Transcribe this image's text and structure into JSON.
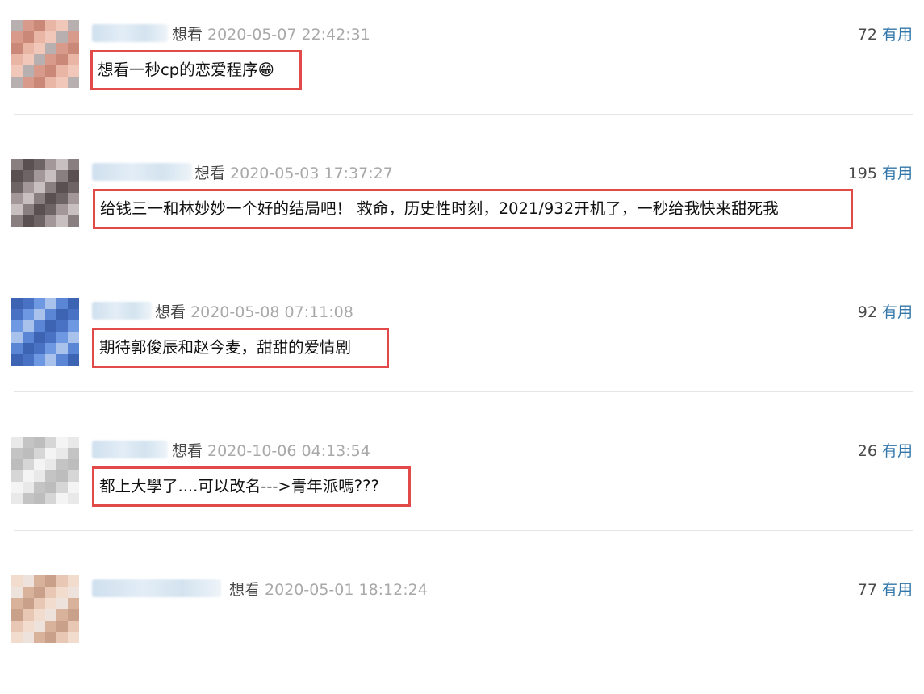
{
  "comments": [
    {
      "status": "想看",
      "time": "2020-05-07 22:42:31",
      "votes": "72",
      "useful": "有用",
      "content": "想看一秒cp的恋爱程序😁"
    },
    {
      "status": "想看",
      "time": "2020-05-03 17:37:27",
      "votes": "195",
      "useful": "有用",
      "content": "给钱三一和林妙妙一个好的结局吧！ 救命，历史性时刻，2021/932开机了，一秒给我快来甜死我"
    },
    {
      "status": "想看",
      "time": "2020-05-08 07:11:08",
      "votes": "92",
      "useful": "有用",
      "content": "期待郭俊辰和赵今麦，甜甜的爱情剧"
    },
    {
      "status": "想看",
      "time": "2020-10-06 04:13:54",
      "votes": "26",
      "useful": "有用",
      "content": "都上大學了....可以改名--->青年派嗎???"
    },
    {
      "status": "想看",
      "time": "2020-05-01 18:12:24",
      "votes": "77",
      "useful": "有用",
      "content": ""
    }
  ],
  "avatar_palettes": [
    [
      "#e9b6a5",
      "#d89a8a",
      "#f0c7b8",
      "#c98878",
      "#b8b0b0"
    ],
    [
      "#6e6466",
      "#8a7f80",
      "#a39799",
      "#5a5052",
      "#c7bfc0"
    ],
    [
      "#4a72c4",
      "#5b86d6",
      "#6f98e2",
      "#3d63b3",
      "#a9c2ec"
    ],
    [
      "#e9e9e9",
      "#d6d6d6",
      "#c4c4c4",
      "#f4f4f4",
      "#bdbdbd"
    ],
    [
      "#e8c8b4",
      "#d9b29c",
      "#f1dccd",
      "#c9a08a",
      "#eee3dc"
    ]
  ]
}
